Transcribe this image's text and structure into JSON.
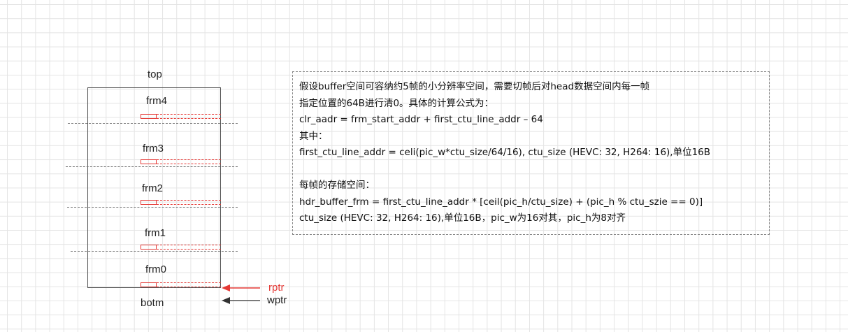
{
  "diagram": {
    "top_label": "top",
    "bottom_label": "botm",
    "frames": [
      "frm4",
      "frm3",
      "frm2",
      "frm1",
      "frm0"
    ],
    "pointers": {
      "rptr": {
        "label": "rptr",
        "color": "#e53935"
      },
      "wptr": {
        "label": "wptr",
        "color": "#333333"
      }
    },
    "colors": {
      "slot": "#e53935",
      "frame_border": "#555555",
      "separator": "#777777",
      "note_border": "#888888"
    }
  },
  "note": {
    "lines": [
      "假设buffer空间可容纳约5帧的小分辨率空间，需要切帧后对head数据空间内每一帧",
      "指定位置的64B进行清0。具体的计算公式为：",
      "clr_aadr = frm_start_addr + first_ctu_line_addr  –  64",
      "其中：",
      "first_ctu_line_addr = celi(pic_w*ctu_size/64/16), ctu_size (HEVC: 32, H264: 16),单位16B",
      "",
      "每帧的存储空间：",
      "hdr_buffer_frm = first_ctu_line_addr * [ceil(pic_h/ctu_size) + (pic_h % ctu_szie == 0)]",
      "ctu_size (HEVC: 32, H264: 16),单位16B，pic_w为16对其，pic_h为8对齐"
    ]
  }
}
